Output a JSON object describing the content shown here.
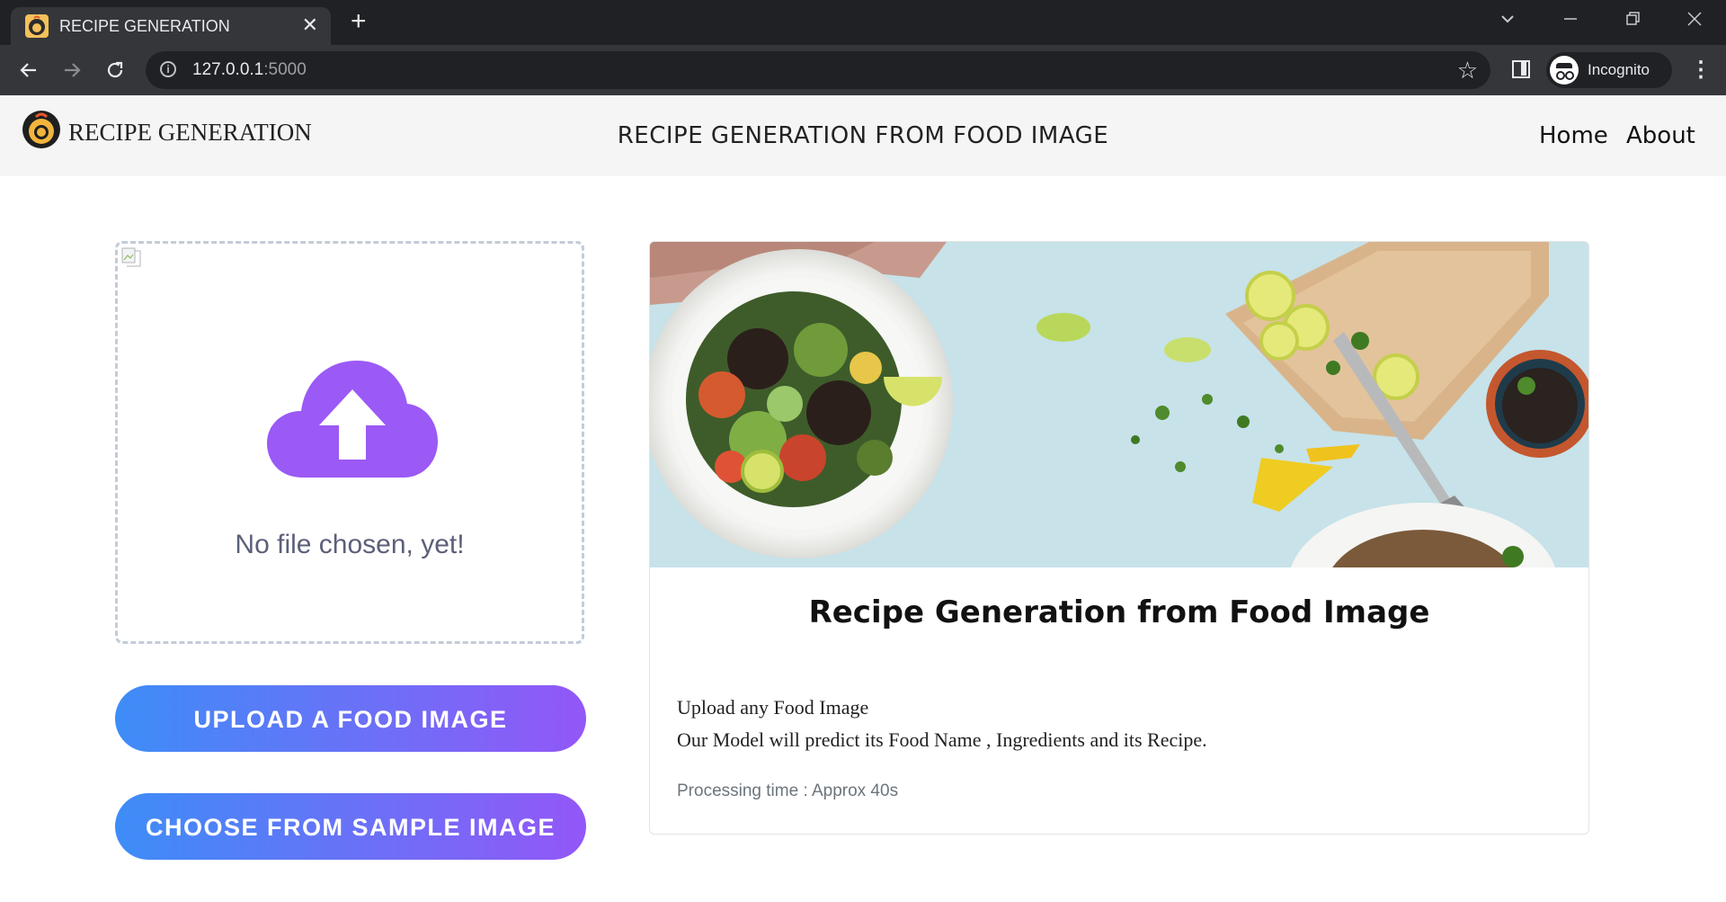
{
  "browser": {
    "tab_title": "RECIPE GENERATION",
    "new_tab_symbol": "+",
    "close_tab_symbol": "✕",
    "url_host": "127.0.0.1",
    "url_port": ":5000",
    "profile_label": "Incognito"
  },
  "navbar": {
    "brand": "RECIPE GENERATION",
    "title": "RECIPE GENERATION FROM FOOD IMAGE",
    "links": [
      "Home",
      "About"
    ]
  },
  "upload": {
    "status": "No file chosen, yet!",
    "upload_button": "UPLOAD A FOOD IMAGE",
    "sample_button": "CHOOSE FROM SAMPLE IMAGE",
    "icon": "cloud-upload-icon"
  },
  "card": {
    "title": "Recipe Generation from Food Image",
    "line1": "Upload any Food Image",
    "line2": "Our Model will predict its Food Name , Ingredients and its Recipe.",
    "processing": "Processing time : Approx 40s"
  },
  "colors": {
    "accent_purple": "#9b59f6",
    "gradient_start": "#3d8df7",
    "gradient_end": "#9357f7",
    "chrome_dark": "#202124"
  }
}
